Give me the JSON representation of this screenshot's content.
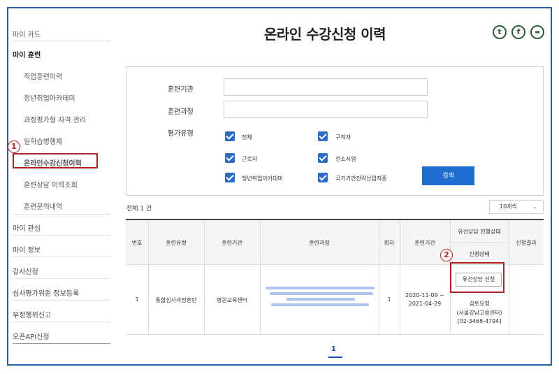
{
  "header": {
    "title": "온라인 수강신청 이력"
  },
  "social": [
    {
      "name": "twitter-icon",
      "glyph": "t"
    },
    {
      "name": "facebook-icon",
      "glyph": "f"
    },
    {
      "name": "share-icon",
      "glyph": "▬"
    }
  ],
  "sidebar": {
    "items": [
      {
        "label": "마이 카드"
      },
      {
        "label": "마이 훈련"
      },
      {
        "label": "직업훈련이력"
      },
      {
        "label": "청년취업아카데미"
      },
      {
        "label": "과정평가형 자격 관리"
      },
      {
        "label": "일학습병행제"
      },
      {
        "label": "온라인수강신청이력"
      },
      {
        "label": "훈련상담 이력조회"
      },
      {
        "label": "훈련문의내역"
      },
      {
        "label": "마이 관심"
      },
      {
        "label": "마이 정보"
      },
      {
        "label": "강사신청"
      },
      {
        "label": "심사평가위원 정보등록"
      },
      {
        "label": "부정행위신고"
      },
      {
        "label": "오픈API신청"
      }
    ]
  },
  "markers": {
    "one": "1",
    "two": "2"
  },
  "search": {
    "institution_label": "훈련기관",
    "institution_value": "",
    "course_label": "훈련과정",
    "course_value": "",
    "eval_type_label": "평가유형",
    "options": [
      {
        "label": "전체",
        "checked": true
      },
      {
        "label": "구직자",
        "checked": true
      },
      {
        "label": "근로자",
        "checked": true
      },
      {
        "label": "전소시엄",
        "checked": true
      },
      {
        "label": "청년취업아카데미",
        "checked": true
      },
      {
        "label": "국가기간전략산업직종",
        "checked": true
      }
    ],
    "button_label": "검색"
  },
  "results": {
    "total_text": "전체 1 건",
    "page_size": "10개씩"
  },
  "table": {
    "headers": {
      "no": "번호",
      "type": "훈련유형",
      "institution": "훈련기관",
      "course": "훈련과정",
      "round": "회차",
      "period": "훈련기간",
      "consult_group": "유선상담 진행상태",
      "consult_status": "신청상태",
      "result": "신청결과"
    },
    "rows": [
      {
        "no": "1",
        "type": "통합심사과정훈련",
        "institution": "병원교육센터",
        "round": "1",
        "period_start": "2020-11-09 ~",
        "period_end": "2021-04-29",
        "consult_button": "유선상담 신청",
        "consult_status_line1": "검토요청",
        "consult_status_line2": "(서울강남고용센터)",
        "consult_status_line3": "[02-3468-4794]",
        "result": ""
      }
    ]
  },
  "pagination": {
    "current": "1"
  },
  "colors": {
    "accent": "#1f6fd1",
    "marker": "#b22222",
    "frame": "#2b5fa8"
  }
}
